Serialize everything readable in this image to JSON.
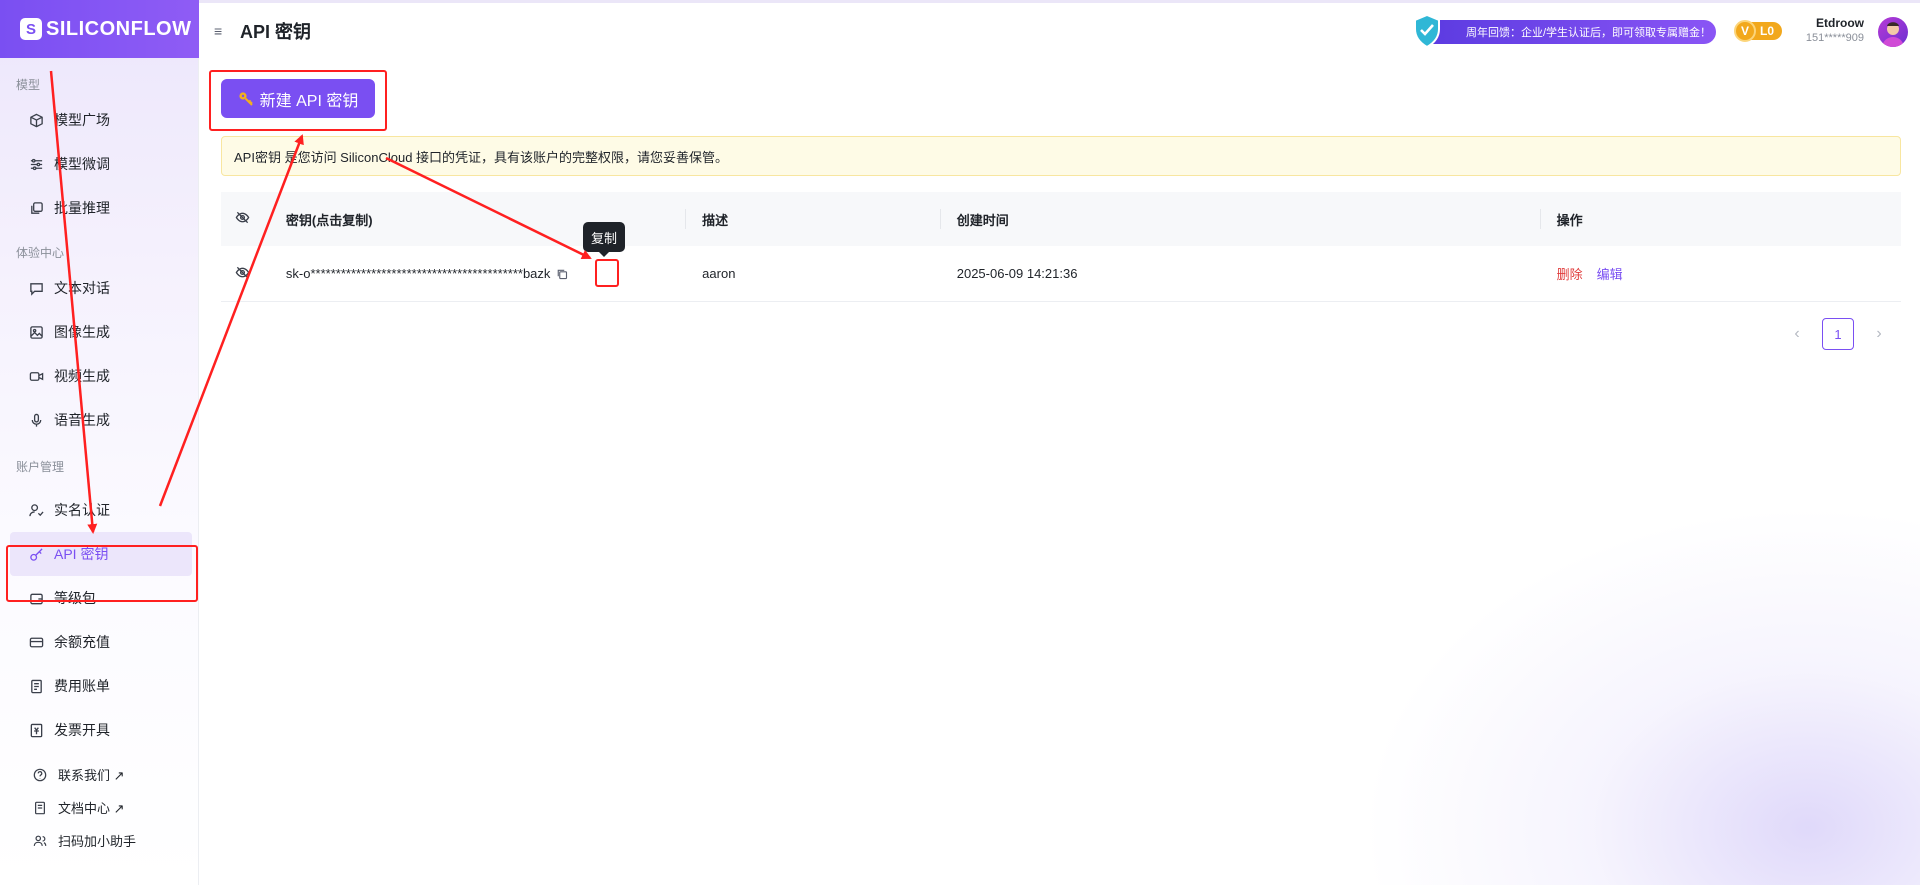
{
  "app": {
    "logo_text": "SILICONFLOW",
    "logo_mark": "S",
    "brand_color": "#7a4ff2"
  },
  "header": {
    "menu_icon": "≡",
    "title": "API 密钥",
    "promo_text": "周年回馈：企业/学生认证后，即可领取专属赠金！",
    "level_v": "V",
    "level_label": "L0",
    "user_name": "Etdroow",
    "user_phone": "151*****909"
  },
  "sidebar": {
    "sections": [
      {
        "title": "模型",
        "items": [
          {
            "label": "模型广场",
            "icon": "cube-icon"
          },
          {
            "label": "模型微调",
            "icon": "sliders-icon"
          },
          {
            "label": "批量推理",
            "icon": "layers-icon"
          }
        ]
      },
      {
        "title": "体验中心",
        "items": [
          {
            "label": "文本对话",
            "icon": "chat-icon"
          },
          {
            "label": "图像生成",
            "icon": "image-icon"
          },
          {
            "label": "视频生成",
            "icon": "video-icon"
          },
          {
            "label": "语音生成",
            "icon": "mic-icon"
          }
        ]
      },
      {
        "title": "账户管理",
        "items": [
          {
            "label": "实名认证",
            "icon": "user-check-icon"
          },
          {
            "label": "API 密钥",
            "icon": "key-icon",
            "active": true
          },
          {
            "label": "等级包",
            "icon": "wallet-icon"
          },
          {
            "label": "余额充值",
            "icon": "card-icon"
          },
          {
            "label": "费用账单",
            "icon": "receipt-icon"
          },
          {
            "label": "发票开具",
            "icon": "invoice-icon"
          }
        ]
      }
    ],
    "footer": [
      {
        "label": "联系我们 ↗",
        "icon": "help-icon"
      },
      {
        "label": "文档中心 ↗",
        "icon": "doc-icon"
      },
      {
        "label": "扫码加小助手",
        "icon": "users-icon"
      }
    ]
  },
  "main": {
    "new_button": "新建 API 密钥",
    "notice": "API密钥 是您访问 SiliconCloud 接口的凭证，具有该账户的完整权限，请您妥善保管。",
    "table": {
      "headers": {
        "key": "密钥(点击复制)",
        "desc": "描述",
        "time": "创建时间",
        "ops": "操作"
      },
      "rows": [
        {
          "key": "sk-o******************************************bazk",
          "desc": "aaron",
          "time": "2025-06-09 14:21:36",
          "delete": "删除",
          "edit": "编辑"
        }
      ]
    },
    "tooltip": "复制",
    "pager": {
      "prev": "‹",
      "current": "1",
      "next": "›"
    }
  },
  "annotation_color": "#ff2020"
}
